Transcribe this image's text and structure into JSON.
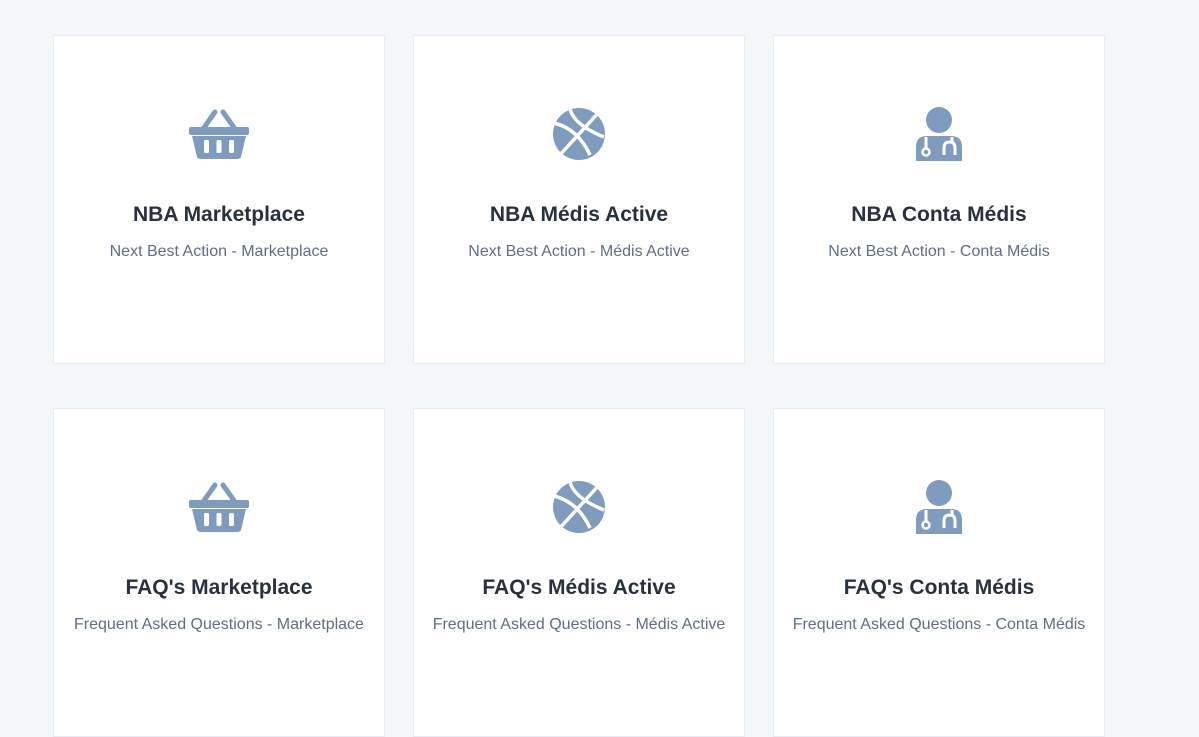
{
  "colors": {
    "background": "#f4f7fa",
    "card": "#ffffff",
    "icon": "#7f9bbd",
    "title": "#28323e",
    "subtitle": "#5d6f86"
  },
  "cards": [
    {
      "icon": "basket-icon",
      "title": "NBA Marketplace",
      "subtitle": "Next Best Action - Marketplace"
    },
    {
      "icon": "basketball-icon",
      "title": "NBA Médis Active",
      "subtitle": "Next Best Action - Médis Active"
    },
    {
      "icon": "doctor-icon",
      "title": "NBA Conta Médis",
      "subtitle": "Next Best Action - Conta Médis"
    },
    {
      "icon": "basket-icon",
      "title": "FAQ's Marketplace",
      "subtitle": "Frequent Asked Questions - Marketplace"
    },
    {
      "icon": "basketball-icon",
      "title": "FAQ's Médis Active",
      "subtitle": "Frequent Asked Questions - Médis Active"
    },
    {
      "icon": "doctor-icon",
      "title": "FAQ's Conta Médis",
      "subtitle": "Frequent Asked Questions - Conta Médis"
    }
  ]
}
